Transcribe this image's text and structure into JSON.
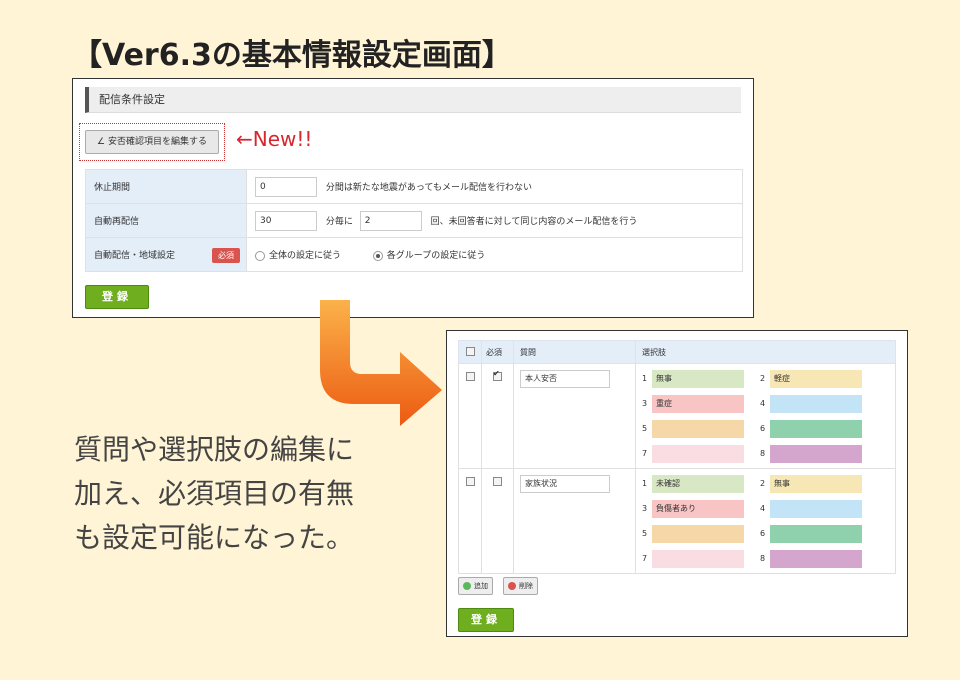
{
  "page_title": "【Ver6.3の基本情報設定画面】",
  "panel1": {
    "header": "配信条件設定",
    "edit_button": "∠ 安否確認項目を編集する",
    "new_note": "←New!!",
    "rows": [
      {
        "label": "休止期間",
        "value": "0",
        "suffix": "分間は新たな地震があってもメール配信を行わない"
      },
      {
        "label": "自動再配信",
        "value": "30",
        "mid": "分毎に",
        "value2": "2",
        "suffix": "回、未回答者に対して同じ内容のメール配信を行う"
      },
      {
        "label": "自動配信・地域設定",
        "badge": "必須",
        "opt1": "全体の設定に従う",
        "opt2": "各グループの設定に従う"
      }
    ],
    "register": "登録"
  },
  "caption": [
    "質問や選択肢の編集に",
    "加え、必須項目の有無",
    "も設定可能になった。"
  ],
  "panel2": {
    "headers": {
      "required": "必須",
      "question": "質問",
      "choices": "選択肢"
    },
    "questions": [
      {
        "question": "本人安否",
        "required": true,
        "choices": [
          {
            "num": "1",
            "text": "無事",
            "color": "#d9e8c4"
          },
          {
            "num": "2",
            "text": "軽症",
            "color": "#f7e7b4"
          },
          {
            "num": "3",
            "text": "重症",
            "color": "#f8c4c4"
          },
          {
            "num": "4",
            "text": "",
            "color": "#c3e3f7"
          },
          {
            "num": "5",
            "text": "",
            "color": "#f6d7a8"
          },
          {
            "num": "6",
            "text": "",
            "color": "#8fd1ac"
          },
          {
            "num": "7",
            "text": "",
            "color": "#fadde2"
          },
          {
            "num": "8",
            "text": "",
            "color": "#d5a6cd"
          }
        ]
      },
      {
        "question": "家族状況",
        "required": false,
        "choices": [
          {
            "num": "1",
            "text": "未確認",
            "color": "#d9e8c4"
          },
          {
            "num": "2",
            "text": "無事",
            "color": "#f7e7b4"
          },
          {
            "num": "3",
            "text": "負傷者あり",
            "color": "#f8c4c4"
          },
          {
            "num": "4",
            "text": "",
            "color": "#c3e3f7"
          },
          {
            "num": "5",
            "text": "",
            "color": "#f6d7a8"
          },
          {
            "num": "6",
            "text": "",
            "color": "#8fd1ac"
          },
          {
            "num": "7",
            "text": "",
            "color": "#fadde2"
          },
          {
            "num": "8",
            "text": "",
            "color": "#d5a6cd"
          }
        ]
      }
    ],
    "add_button": "追加",
    "delete_button": "削除",
    "register": "登録"
  },
  "colors": {
    "accent_green": "#6fae1f",
    "new_red": "#d9262e",
    "arrow_orange": "#f07a1a"
  }
}
